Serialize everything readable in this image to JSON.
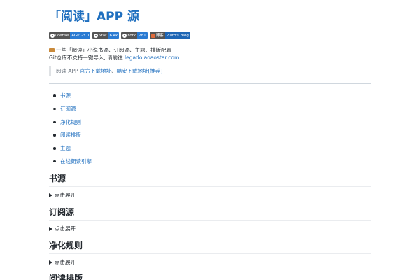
{
  "title": "「阅读」APP 源",
  "badges": [
    {
      "left": "license",
      "right": "AGPL-3.0",
      "icon": "github-icon"
    },
    {
      "left": "Star",
      "right": "6.4k",
      "icon": "github-icon"
    },
    {
      "left": "Fork",
      "right": "281",
      "icon": "github-icon"
    },
    {
      "left": "博客",
      "right": "Pluto's Blog",
      "icon": "blog-icon"
    }
  ],
  "description": {
    "line1": "一些「阅读」小说书源、订阅源、主题、排版配置",
    "line2_prefix": "Git仓库不支持一键导入, 请前往 ",
    "line2_link": "legado.aoaostar.com"
  },
  "quote": {
    "prefix": "阅读 APP ",
    "link1": "官方下载地址",
    "separator": "、",
    "link2": "酷安下载地址[推荐]"
  },
  "toc": [
    "书源",
    "订阅源",
    "净化规则",
    "阅读排版",
    "主题",
    "在线朗读引擎"
  ],
  "sections": [
    {
      "heading": "书源",
      "toggle": "点击展开"
    },
    {
      "heading": "订阅源",
      "toggle": "点击展开"
    },
    {
      "heading": "净化规则",
      "toggle": "点击展开"
    },
    {
      "heading": "阅读排版",
      "toggle": ""
    }
  ],
  "colors": {
    "link": "#1f6fbf",
    "badge_blue": "#2a7bd3",
    "badge_gray": "#555555"
  }
}
